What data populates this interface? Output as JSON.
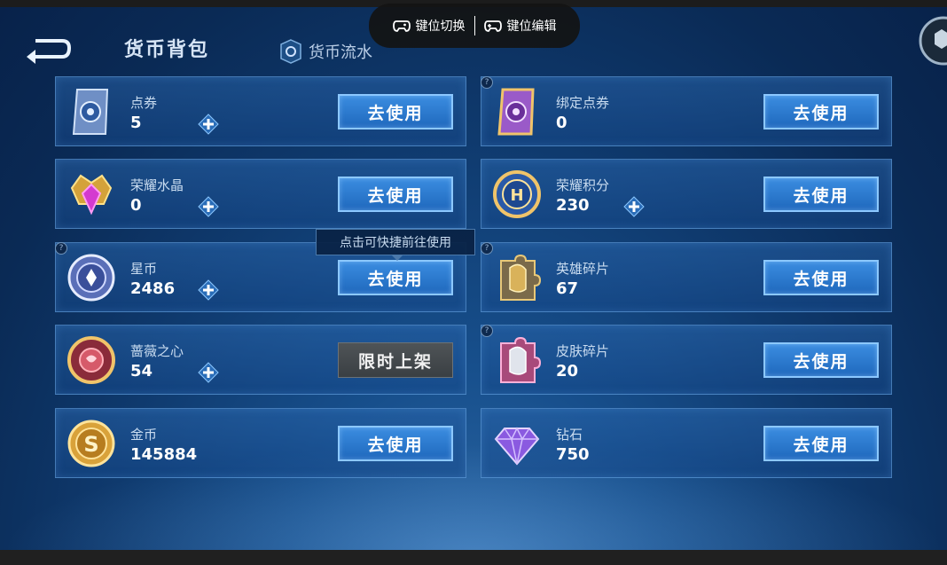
{
  "header": {
    "title": "货币背包",
    "flow_tab": "货币流水"
  },
  "overlay": {
    "switch_label": "键位切换",
    "edit_label": "键位编辑"
  },
  "tooltip": "点击可快捷前往使用",
  "use_label": "去使用",
  "left_cards": [
    {
      "name": "点券",
      "amount": "5",
      "icon": "voucher-icon"
    },
    {
      "name": "荣耀水晶",
      "amount": "0",
      "icon": "glory-crystal-icon"
    },
    {
      "name": "星币",
      "amount": "2486",
      "icon": "star-coin-icon"
    },
    {
      "name": "蔷薇之心",
      "amount": "54",
      "icon": "rose-heart-icon",
      "action": "限时上架"
    },
    {
      "name": "金币",
      "amount": "145884",
      "icon": "gold-coin-icon"
    }
  ],
  "right_cards": [
    {
      "name": "绑定点券",
      "amount": "0",
      "icon": "bound-voucher-icon"
    },
    {
      "name": "荣耀积分",
      "amount": "230",
      "icon": "honor-points-icon"
    },
    {
      "name": "英雄碎片",
      "amount": "67",
      "icon": "hero-fragment-icon"
    },
    {
      "name": "皮肤碎片",
      "amount": "20",
      "icon": "skin-fragment-icon"
    },
    {
      "name": "钻石",
      "amount": "750",
      "icon": "diamond-icon"
    }
  ],
  "help_mark": "?"
}
